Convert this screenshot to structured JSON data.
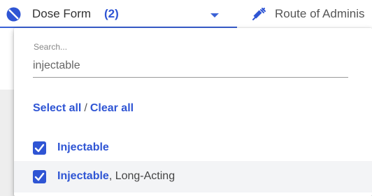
{
  "filter_bar": {
    "dose_form": {
      "icon": "pill-capsule-icon",
      "label": "Dose Form",
      "count": "(2)",
      "caret_icon": "caret-down-icon"
    },
    "route": {
      "icon": "syringe-icon",
      "label": "Route of Adminis"
    }
  },
  "dropdown": {
    "search": {
      "placeholder": "Search...",
      "value": "injectable"
    },
    "select_all": "Select all",
    "separator": "/",
    "clear_all": "Clear all",
    "options": [
      {
        "match": "Injectable",
        "rest": "",
        "checked": true
      },
      {
        "match": "Injectable",
        "rest": ", Long-Acting",
        "checked": true
      }
    ]
  },
  "colors": {
    "accent": "#2f55d4",
    "hover_row": "#f3f4f6"
  }
}
